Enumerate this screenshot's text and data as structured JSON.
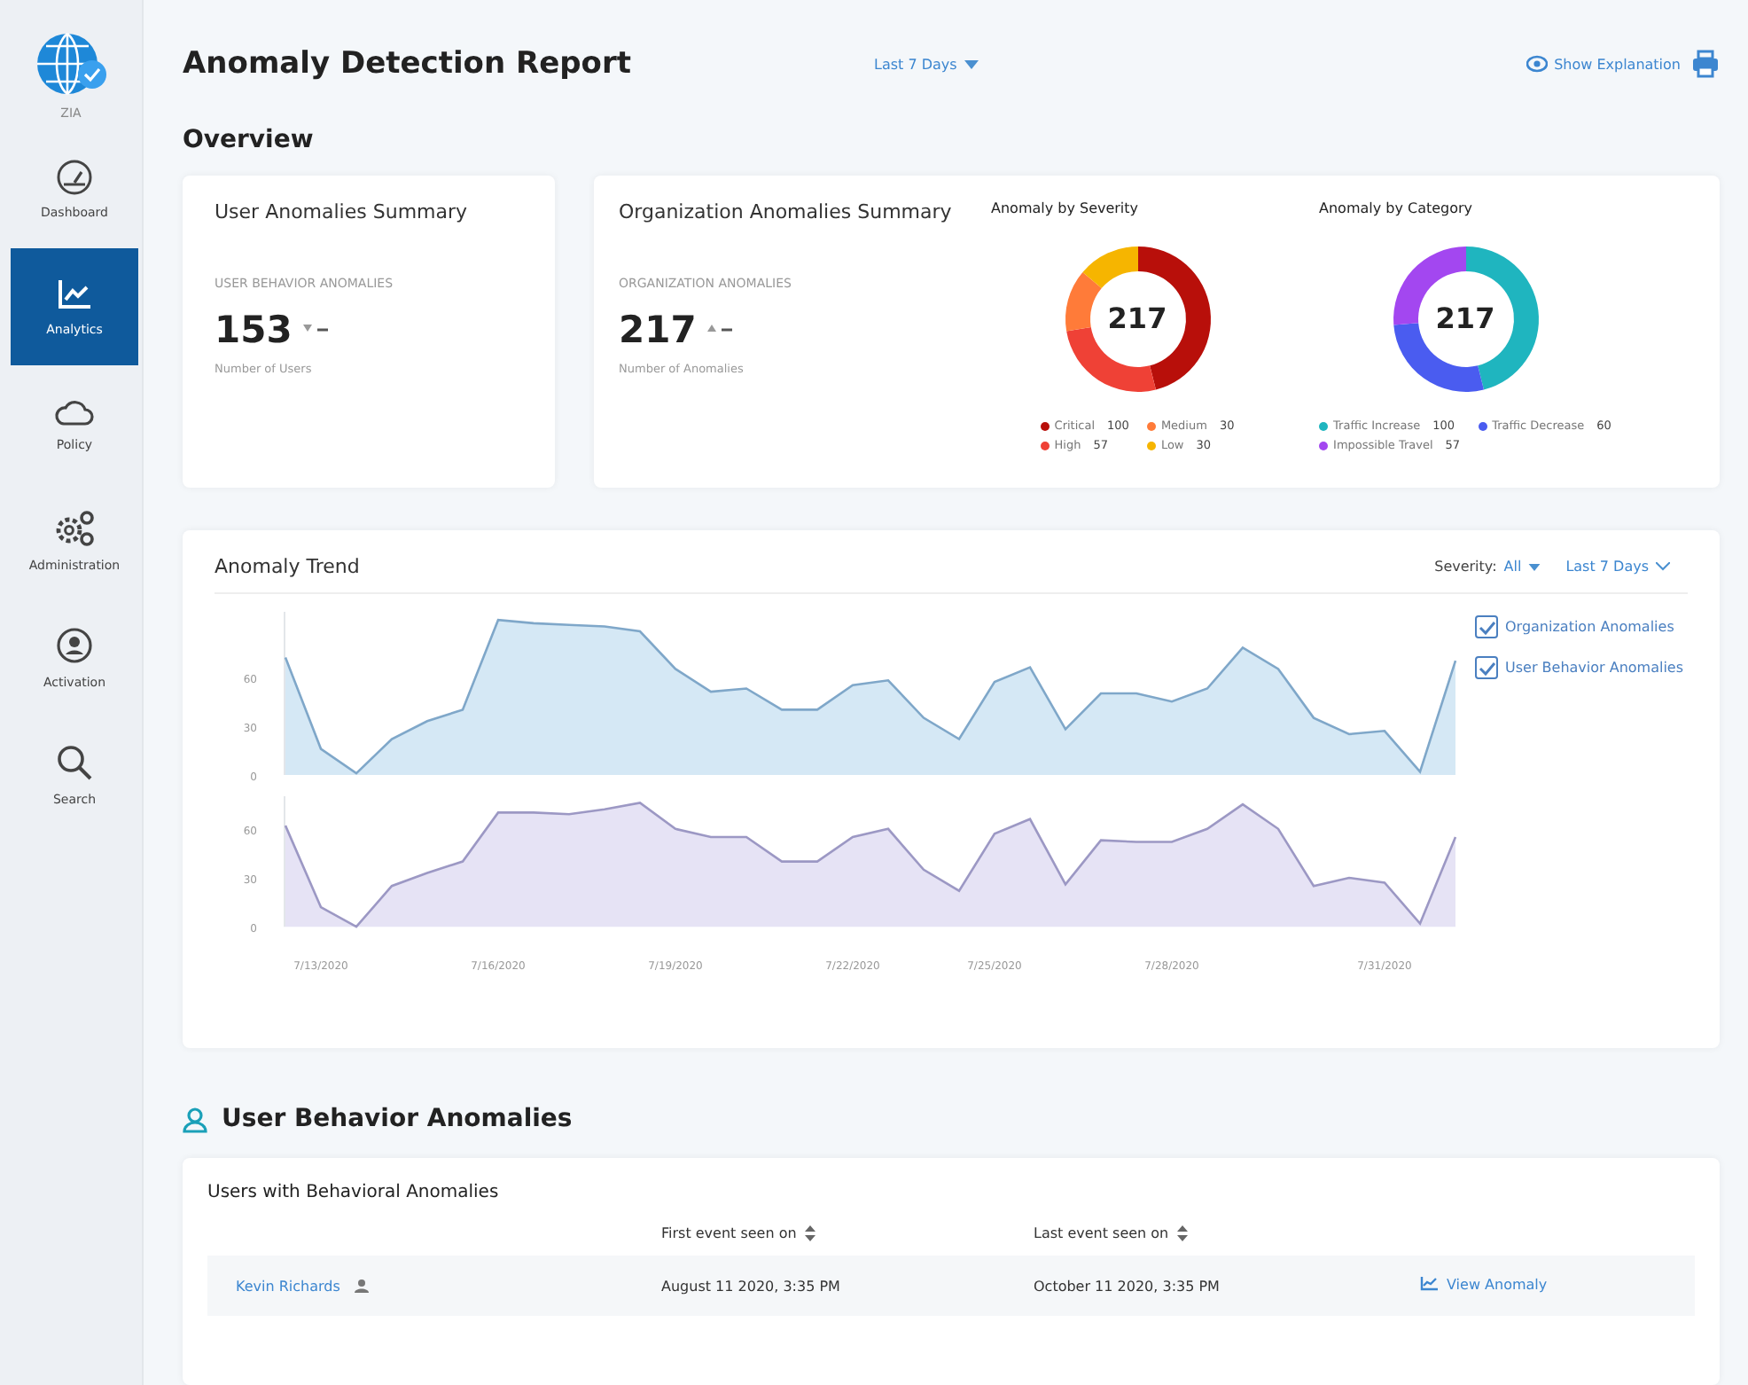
{
  "sidebar": {
    "brand": "ZIA",
    "items": [
      {
        "label": "Dashboard",
        "kind": "gauge",
        "selected": false
      },
      {
        "label": "Analytics",
        "kind": "chart",
        "selected": true
      },
      {
        "label": "Policy",
        "kind": "cloud",
        "selected": false
      },
      {
        "label": "Administration",
        "kind": "gears",
        "selected": false
      },
      {
        "label": "Activation",
        "kind": "person",
        "selected": false
      },
      {
        "label": "Search",
        "kind": "search",
        "selected": false
      }
    ]
  },
  "header": {
    "title": "Anomaly Detection Report",
    "date_filter": "Last 7 Days",
    "explanation_link": "Show Explanation"
  },
  "overview": {
    "heading": "Overview",
    "user_summary": {
      "title": "User Anomalies Summary",
      "metric_label": "USER BEHAVIOR ANOMALIES",
      "value": "153",
      "caption": "Number of Users"
    },
    "org_summary": {
      "title": "Organization Anomalies Summary",
      "metric_label": "ORGANIZATION ANOMALIES",
      "value": "217",
      "caption": "Number of Anomalies"
    },
    "donuts": [
      {
        "title": "Anomaly by Severity",
        "total": "217",
        "legend": [
          {
            "label": "Critical",
            "value": "100",
            "color": "#b80f0a"
          },
          {
            "label": "High",
            "value": "57",
            "color": "#ef4136"
          },
          {
            "label": "Medium",
            "value": "30",
            "color": "#ff7b39"
          },
          {
            "label": "Low",
            "value": "30",
            "color": "#f6b500"
          }
        ]
      },
      {
        "title": "Anomaly by Category",
        "total": "217",
        "legend": [
          {
            "label": "Traffic Increase",
            "value": "100",
            "color": "#1fb5bf"
          },
          {
            "label": "Traffic Decrease",
            "value": "60",
            "color": "#4a5cf0"
          },
          {
            "label": "Impossible Travel",
            "value": "57",
            "color": "#a347f0"
          }
        ]
      }
    ]
  },
  "trend": {
    "title": "Anomaly Trend",
    "severity_label": "Severity:",
    "severity_value": "All",
    "date_filter": "Last 7 Days",
    "legend": [
      {
        "checked": true
      },
      {
        "checked": true
      }
    ],
    "charts": [
      {
        "chart_data": {
          "type": "area",
          "ylim": [
            0,
            100
          ],
          "yticks": [
            0,
            30,
            60
          ],
          "categories": [
            null,
            null,
            null,
            null,
            null,
            null,
            null,
            null,
            null,
            null,
            null,
            null,
            null,
            null,
            null,
            null,
            null,
            null,
            null,
            null,
            null,
            null,
            null,
            null,
            null,
            null,
            null,
            null,
            null,
            null,
            null,
            null,
            null,
            null
          ],
          "series": [
            {
              "name": "Organization Anomalies",
              "color": "#7fa7c9",
              "values": [
                72,
                16,
                1,
                22,
                33,
                40,
                95,
                93,
                92,
                91,
                88,
                65,
                51,
                53,
                40,
                40,
                55,
                58,
                35,
                22,
                57,
                66,
                28,
                50,
                50,
                45,
                53,
                78,
                65,
                35,
                25,
                27,
                2,
                70
              ]
            }
          ]
        }
      },
      {
        "chart_data": {
          "type": "area",
          "ylim": [
            0,
            80
          ],
          "yticks": [
            0,
            30,
            60
          ],
          "categories": [
            null,
            "7/13/2020",
            null,
            null,
            null,
            null,
            "7/16/2020",
            null,
            null,
            null,
            null,
            "7/19/2020",
            null,
            null,
            null,
            null,
            "7/22/2020",
            null,
            null,
            null,
            "7/25/2020",
            null,
            null,
            null,
            null,
            "7/28/2020",
            null,
            null,
            null,
            null,
            null,
            "7/31/2020",
            null,
            null
          ],
          "series": [
            {
              "name": "User Behavior Anomalies",
              "color": "#9c98c4",
              "values": [
                62,
                12,
                0,
                25,
                33,
                40,
                70,
                70,
                69,
                72,
                76,
                60,
                55,
                55,
                40,
                40,
                55,
                60,
                35,
                22,
                57,
                66,
                26,
                53,
                52,
                52,
                60,
                75,
                60,
                25,
                30,
                27,
                2,
                55
              ]
            }
          ]
        }
      }
    ]
  },
  "behavior": {
    "heading": "User Behavior Anomalies",
    "table": {
      "title": "Users with Behavioral Anomalies",
      "columns": [
        "First event seen on",
        "Last event seen on"
      ],
      "rows": [
        {
          "user": "Kevin Richards",
          "first": "August 11 2020, 3:35 PM",
          "last": "October 11 2020, 3:35 PM",
          "action": "View Anomaly"
        }
      ]
    }
  }
}
